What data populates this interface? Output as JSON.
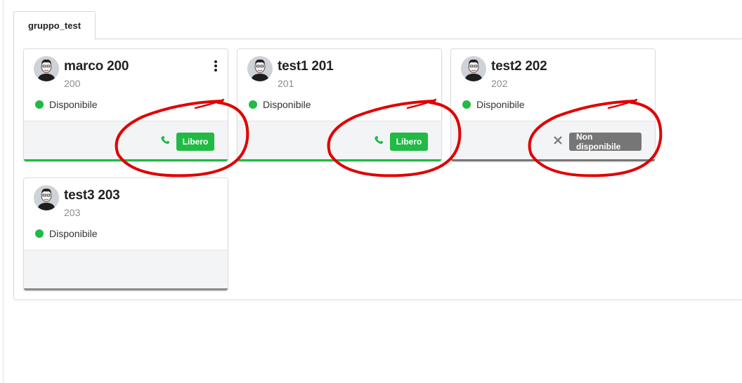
{
  "tab": {
    "label": "gruppo_test"
  },
  "cards": [
    {
      "name": "marco 200",
      "ext": "200",
      "status": "Disponibile",
      "badge": "Libero",
      "badge_state": "free",
      "status_color": "#21ba45"
    },
    {
      "name": "test1 201",
      "ext": "201",
      "status": "Disponibile",
      "badge": "Libero",
      "badge_state": "free",
      "status_color": "#21ba45"
    },
    {
      "name": "test2 202",
      "ext": "202",
      "status": "Disponibile",
      "badge": "Non disponibile",
      "badge_state": "unavailable",
      "status_color": "#21ba45"
    },
    {
      "name": "test3 203",
      "ext": "203",
      "status": "Disponibile",
      "badge": null,
      "badge_state": "none",
      "status_color": "#21ba45"
    }
  ],
  "colors": {
    "green": "#21ba45",
    "grey": "#767676",
    "annotation_red": "#e00000"
  },
  "icons": {
    "phone": "phone-icon",
    "unavailable": "close-icon",
    "menu": "more-vertical-icon"
  }
}
